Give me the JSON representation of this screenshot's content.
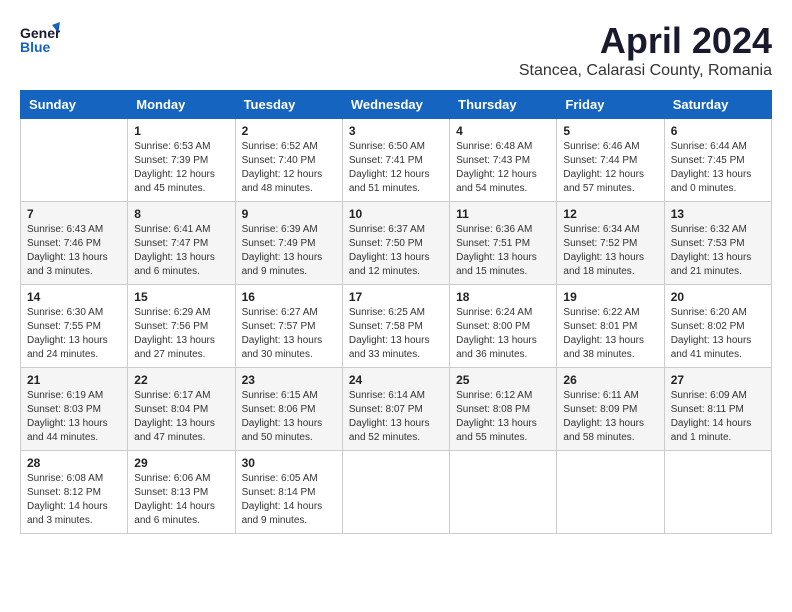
{
  "header": {
    "logo_line1": "General",
    "logo_line2": "Blue",
    "title": "April 2024",
    "subtitle": "Stancea, Calarasi County, Romania"
  },
  "weekdays": [
    "Sunday",
    "Monday",
    "Tuesday",
    "Wednesday",
    "Thursday",
    "Friday",
    "Saturday"
  ],
  "weeks": [
    [
      {
        "day": "",
        "info": ""
      },
      {
        "day": "1",
        "info": "Sunrise: 6:53 AM\nSunset: 7:39 PM\nDaylight: 12 hours\nand 45 minutes."
      },
      {
        "day": "2",
        "info": "Sunrise: 6:52 AM\nSunset: 7:40 PM\nDaylight: 12 hours\nand 48 minutes."
      },
      {
        "day": "3",
        "info": "Sunrise: 6:50 AM\nSunset: 7:41 PM\nDaylight: 12 hours\nand 51 minutes."
      },
      {
        "day": "4",
        "info": "Sunrise: 6:48 AM\nSunset: 7:43 PM\nDaylight: 12 hours\nand 54 minutes."
      },
      {
        "day": "5",
        "info": "Sunrise: 6:46 AM\nSunset: 7:44 PM\nDaylight: 12 hours\nand 57 minutes."
      },
      {
        "day": "6",
        "info": "Sunrise: 6:44 AM\nSunset: 7:45 PM\nDaylight: 13 hours\nand 0 minutes."
      }
    ],
    [
      {
        "day": "7",
        "info": "Sunrise: 6:43 AM\nSunset: 7:46 PM\nDaylight: 13 hours\nand 3 minutes."
      },
      {
        "day": "8",
        "info": "Sunrise: 6:41 AM\nSunset: 7:47 PM\nDaylight: 13 hours\nand 6 minutes."
      },
      {
        "day": "9",
        "info": "Sunrise: 6:39 AM\nSunset: 7:49 PM\nDaylight: 13 hours\nand 9 minutes."
      },
      {
        "day": "10",
        "info": "Sunrise: 6:37 AM\nSunset: 7:50 PM\nDaylight: 13 hours\nand 12 minutes."
      },
      {
        "day": "11",
        "info": "Sunrise: 6:36 AM\nSunset: 7:51 PM\nDaylight: 13 hours\nand 15 minutes."
      },
      {
        "day": "12",
        "info": "Sunrise: 6:34 AM\nSunset: 7:52 PM\nDaylight: 13 hours\nand 18 minutes."
      },
      {
        "day": "13",
        "info": "Sunrise: 6:32 AM\nSunset: 7:53 PM\nDaylight: 13 hours\nand 21 minutes."
      }
    ],
    [
      {
        "day": "14",
        "info": "Sunrise: 6:30 AM\nSunset: 7:55 PM\nDaylight: 13 hours\nand 24 minutes."
      },
      {
        "day": "15",
        "info": "Sunrise: 6:29 AM\nSunset: 7:56 PM\nDaylight: 13 hours\nand 27 minutes."
      },
      {
        "day": "16",
        "info": "Sunrise: 6:27 AM\nSunset: 7:57 PM\nDaylight: 13 hours\nand 30 minutes."
      },
      {
        "day": "17",
        "info": "Sunrise: 6:25 AM\nSunset: 7:58 PM\nDaylight: 13 hours\nand 33 minutes."
      },
      {
        "day": "18",
        "info": "Sunrise: 6:24 AM\nSunset: 8:00 PM\nDaylight: 13 hours\nand 36 minutes."
      },
      {
        "day": "19",
        "info": "Sunrise: 6:22 AM\nSunset: 8:01 PM\nDaylight: 13 hours\nand 38 minutes."
      },
      {
        "day": "20",
        "info": "Sunrise: 6:20 AM\nSunset: 8:02 PM\nDaylight: 13 hours\nand 41 minutes."
      }
    ],
    [
      {
        "day": "21",
        "info": "Sunrise: 6:19 AM\nSunset: 8:03 PM\nDaylight: 13 hours\nand 44 minutes."
      },
      {
        "day": "22",
        "info": "Sunrise: 6:17 AM\nSunset: 8:04 PM\nDaylight: 13 hours\nand 47 minutes."
      },
      {
        "day": "23",
        "info": "Sunrise: 6:15 AM\nSunset: 8:06 PM\nDaylight: 13 hours\nand 50 minutes."
      },
      {
        "day": "24",
        "info": "Sunrise: 6:14 AM\nSunset: 8:07 PM\nDaylight: 13 hours\nand 52 minutes."
      },
      {
        "day": "25",
        "info": "Sunrise: 6:12 AM\nSunset: 8:08 PM\nDaylight: 13 hours\nand 55 minutes."
      },
      {
        "day": "26",
        "info": "Sunrise: 6:11 AM\nSunset: 8:09 PM\nDaylight: 13 hours\nand 58 minutes."
      },
      {
        "day": "27",
        "info": "Sunrise: 6:09 AM\nSunset: 8:11 PM\nDaylight: 14 hours\nand 1 minute."
      }
    ],
    [
      {
        "day": "28",
        "info": "Sunrise: 6:08 AM\nSunset: 8:12 PM\nDaylight: 14 hours\nand 3 minutes."
      },
      {
        "day": "29",
        "info": "Sunrise: 6:06 AM\nSunset: 8:13 PM\nDaylight: 14 hours\nand 6 minutes."
      },
      {
        "day": "30",
        "info": "Sunrise: 6:05 AM\nSunset: 8:14 PM\nDaylight: 14 hours\nand 9 minutes."
      },
      {
        "day": "",
        "info": ""
      },
      {
        "day": "",
        "info": ""
      },
      {
        "day": "",
        "info": ""
      },
      {
        "day": "",
        "info": ""
      }
    ]
  ]
}
